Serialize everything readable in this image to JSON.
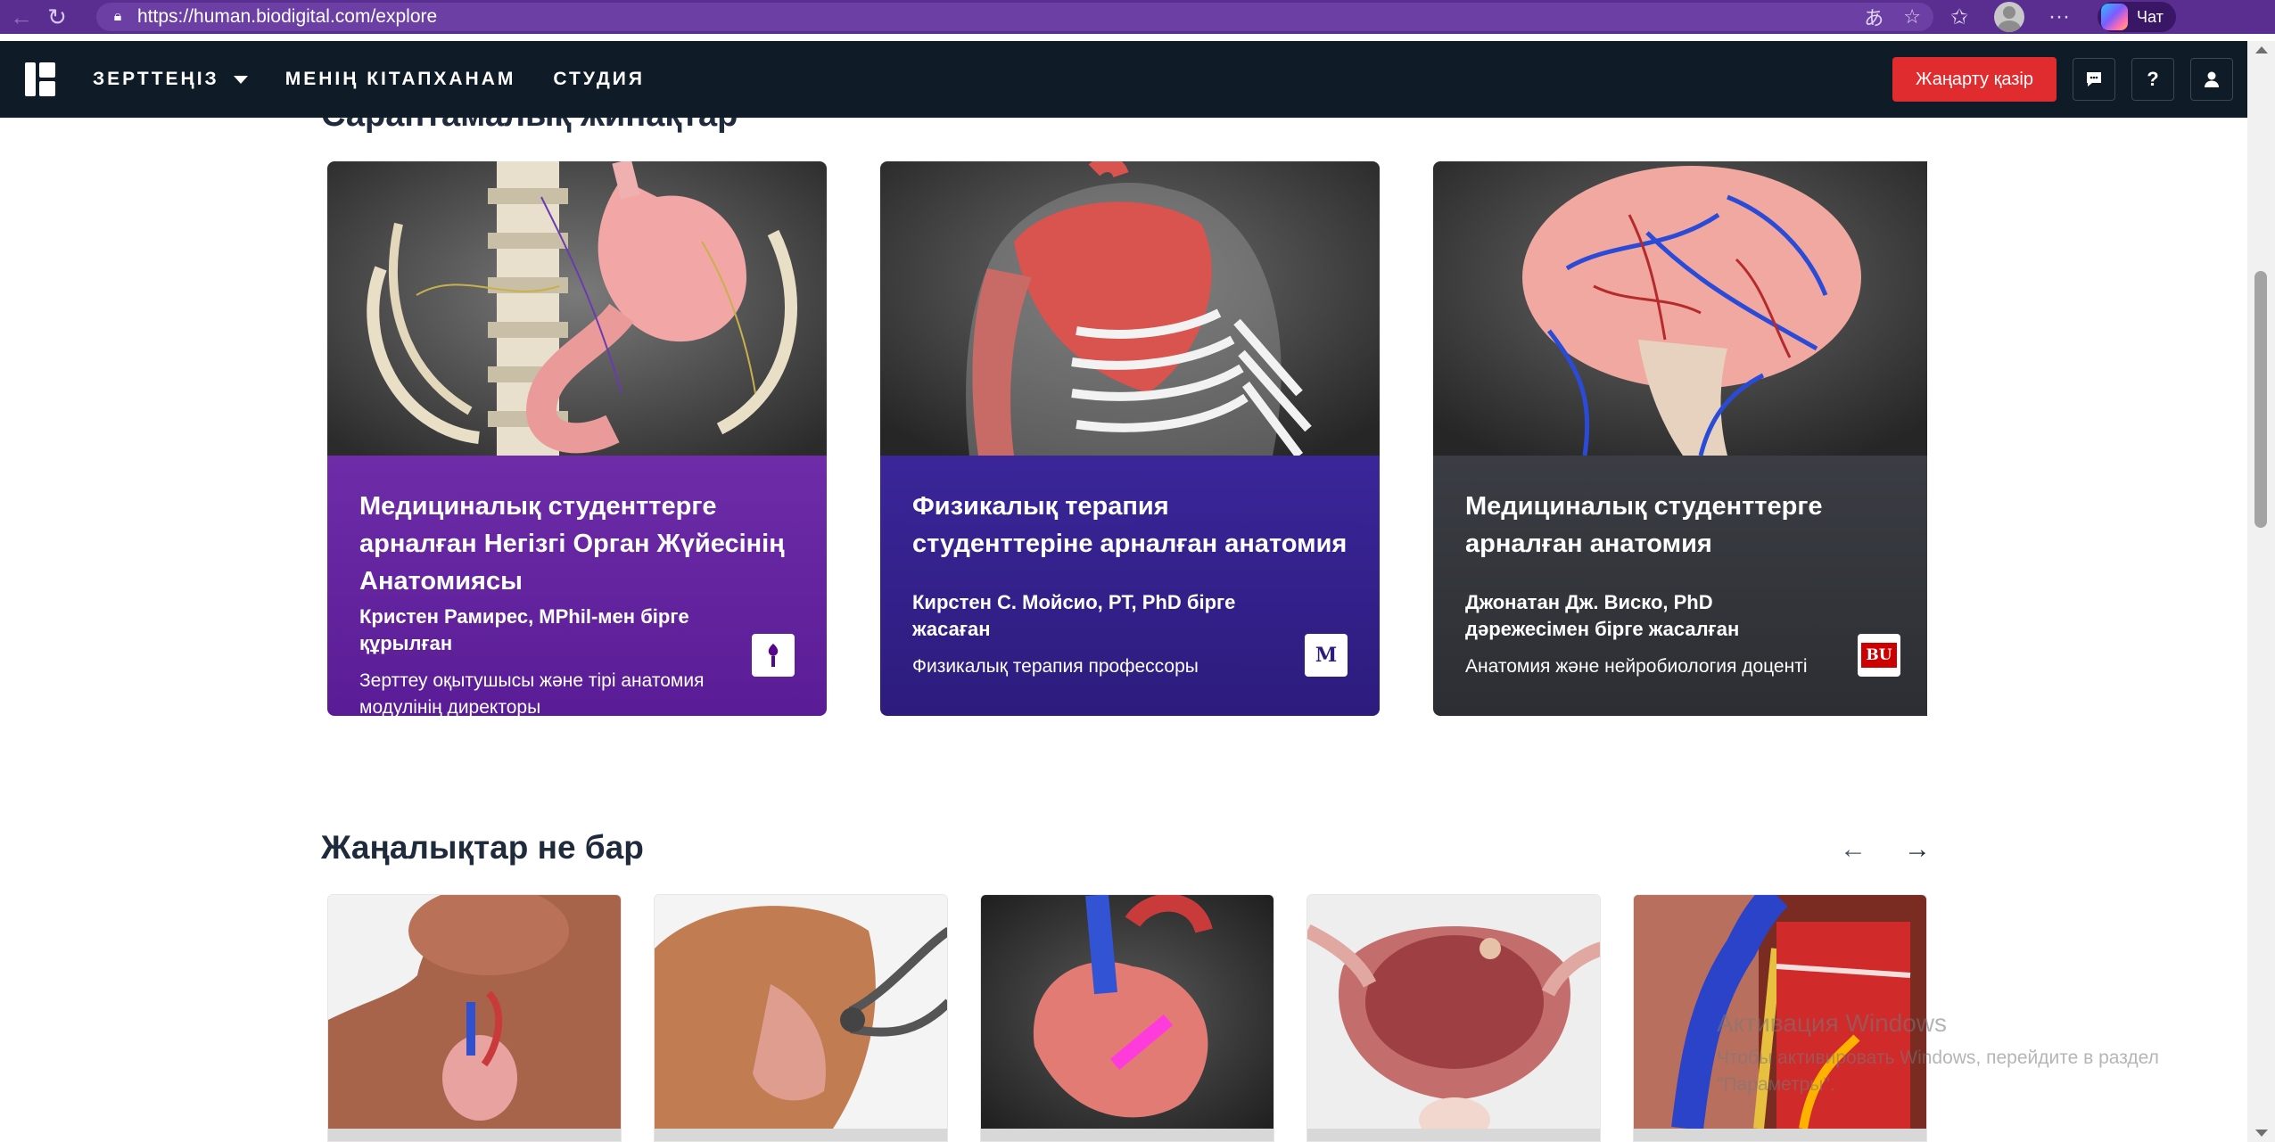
{
  "browser": {
    "url": "https://human.biodigital.com/explore",
    "chat_label": "Чат"
  },
  "header": {
    "nav": [
      {
        "label": "ЗЕРТТЕҢІЗ"
      },
      {
        "label": "МЕНІҢ КІТАПХАНАМ"
      },
      {
        "label": "СТУДИЯ"
      }
    ],
    "cta_label": "Жаңарту қазір"
  },
  "expert_section": {
    "title": "Сараптамалық жинақтар"
  },
  "featured": [
    {
      "title": "Медициналық студенттерге арналған Негізгі Орган Жүйесінің Анатомиясы",
      "author": "Кристен Рамирес, MPhil-мен бірге құрылған",
      "role": "Зерттеу оқытушысы және тірі анатомия модулінің директоры",
      "badge": "𝛙",
      "color": "#6a23a6"
    },
    {
      "title": "Физикалық терапия студенттеріне арналған анатомия",
      "author": "Кирстен С. Мойсио, PT, PhD бірге жасаған",
      "role": "Физикалық терапия профессоры",
      "badge": "M",
      "color": "#3a1f8f"
    },
    {
      "title": "Медициналық студенттерге арналған анатомия",
      "author": "Джонатан Дж. Виско, PhD дәрежесімен бірге жасалған",
      "role": "Анатомия және нейробиология доценті",
      "badge": "BU",
      "color": "#2f3238"
    }
  ],
  "news_section": {
    "title": "Жаңалықтар не бар"
  },
  "watermark": {
    "title": "Активация Windows",
    "subtitle": "Чтобы активировать Windows, перейдите в раздел \"Параметры\"."
  }
}
